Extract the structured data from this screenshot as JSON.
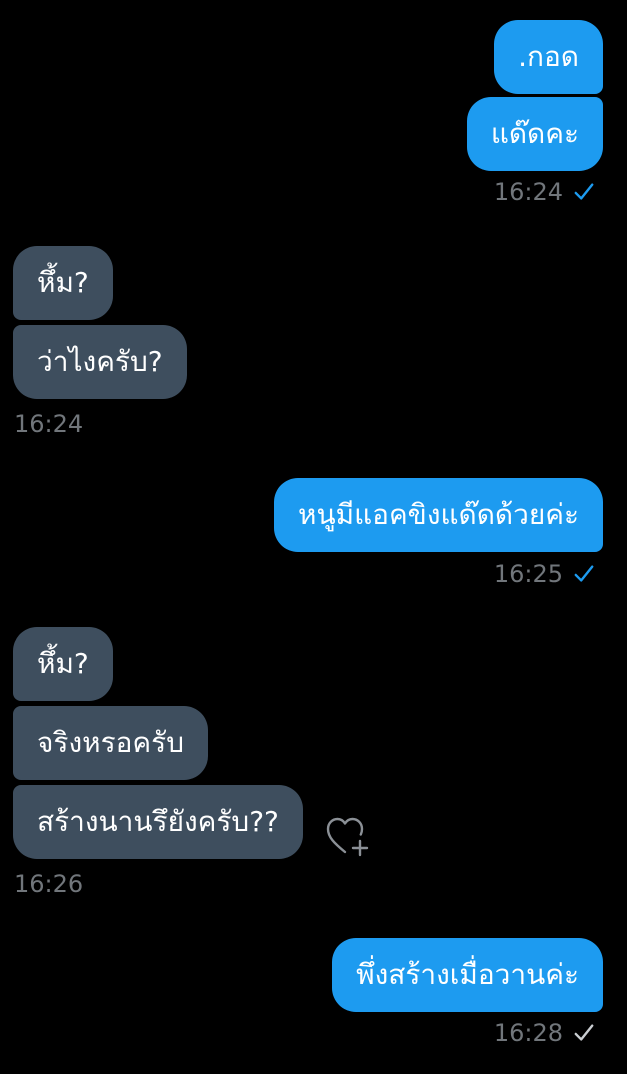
{
  "messages": [
    {
      "side": "out",
      "text": ".กอด"
    },
    {
      "side": "out",
      "text": "แด๊ดคะ"
    },
    {
      "side": "out",
      "time": "16:24",
      "status": "sent-check-blue"
    },
    {
      "side": "in",
      "text": "หึ้ม?"
    },
    {
      "side": "in",
      "text": "ว่าไงครับ?"
    },
    {
      "side": "in",
      "time": "16:24"
    },
    {
      "side": "out",
      "text": "หนูมีแอคขิงแด๊ดด้วยค่ะ"
    },
    {
      "side": "out",
      "time": "16:25",
      "status": "sent-check-blue"
    },
    {
      "side": "in",
      "text": "หึ้ม?"
    },
    {
      "side": "in",
      "text": "จริงหรอครับ"
    },
    {
      "side": "in",
      "text": "สร้างนานรึยังครับ??"
    },
    {
      "side": "in",
      "time": "16:26"
    },
    {
      "side": "out",
      "text": "พึ่งสร้างเมื่อวานค่ะ"
    },
    {
      "side": "out",
      "time": "16:28",
      "status": "sent-check-gray"
    }
  ],
  "colors": {
    "outgoing_bubble": "#1d9bf0",
    "incoming_bubble": "#3e4e5e",
    "timestamp": "#71767b",
    "check_blue": "#1d9bf0",
    "check_gray": "#c9cdd1"
  },
  "icons": {
    "react": "heart-plus-icon",
    "sent": "checkmark-icon"
  }
}
